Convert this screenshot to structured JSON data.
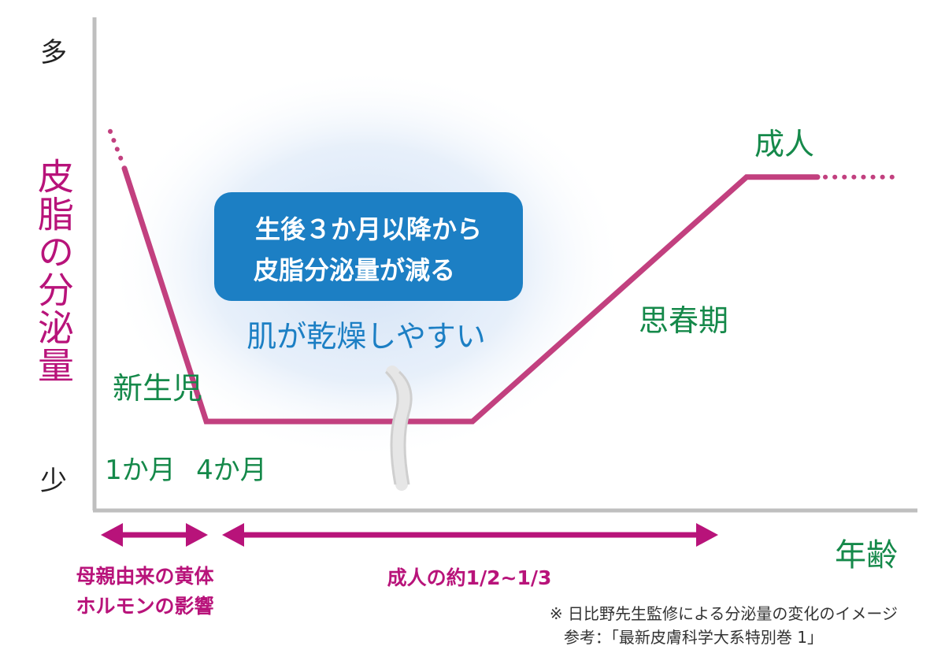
{
  "colors": {
    "line": "#c2407f",
    "green": "#15894a",
    "magenta": "#b8137a",
    "blue_box": "#1c7fc4",
    "axis": "#bfbfbf"
  },
  "chart_data": {
    "type": "line",
    "title": "",
    "ylabel": "皮脂の分泌量",
    "xlabel": "年齢",
    "y_top_label": "多",
    "y_bottom_label": "少",
    "series": [
      {
        "points": [
          {
            "stage": "新生児",
            "level": 0.88
          },
          {
            "stage": "4か月",
            "level": 0.0
          },
          {
            "stage": "思春期開始",
            "level": 0.0
          },
          {
            "stage": "成人",
            "level": 0.85
          }
        ]
      }
    ],
    "stage_labels": {
      "newborn": "新生児",
      "adolescence": "思春期",
      "adult": "成人",
      "one_month": "1か月",
      "four_months": "4か月"
    },
    "callout": {
      "line1": "生後３か月以降から",
      "line2": "皮脂分泌量が減る",
      "sub": "肌が乾燥しやすい"
    },
    "ranges": [
      {
        "line1": "母親由来の黄体",
        "line2": "ホルモンの影響"
      },
      {
        "line1": "成人の約1/2~1/3"
      }
    ],
    "notes": {
      "line1": "※ 日比野先生監修による分泌量の変化のイメージ",
      "line2": "参考：「最新皮膚科学大系特別巻 1」"
    }
  }
}
